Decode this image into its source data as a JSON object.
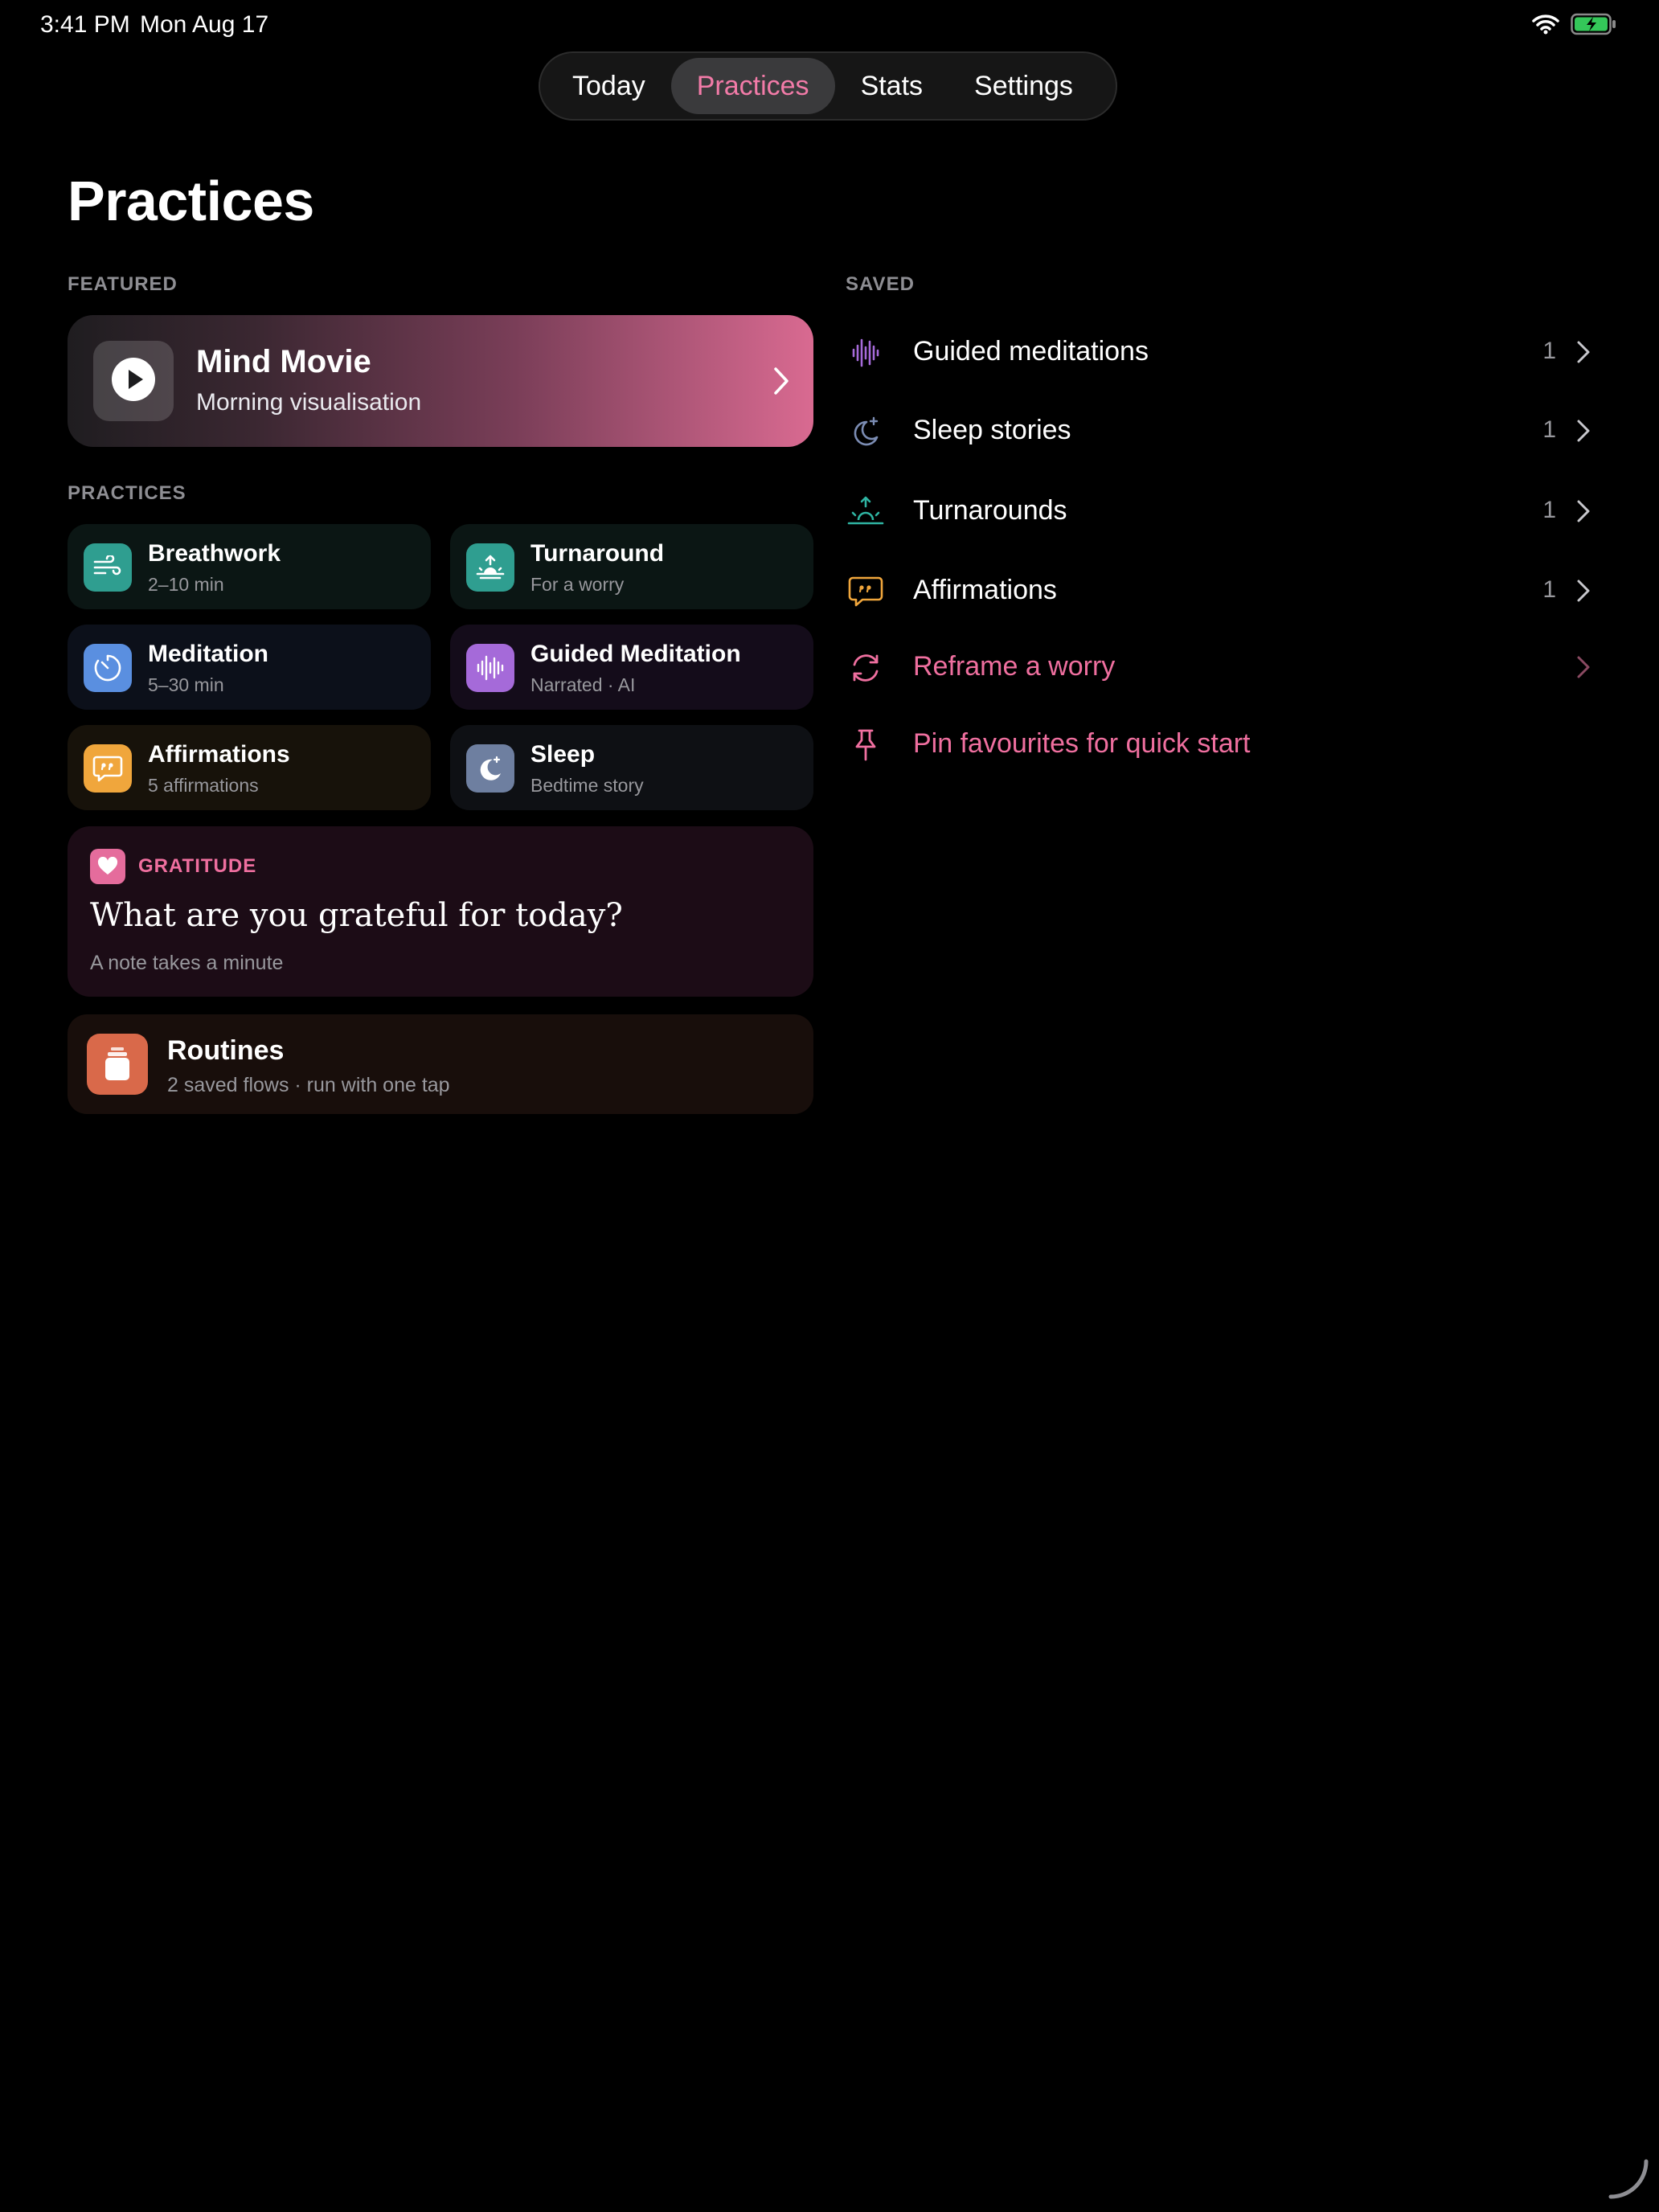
{
  "status": {
    "time": "3:41 PM",
    "date": "Mon Aug 17",
    "wifi_icon": "wifi-icon",
    "battery_icon": "battery-charging-icon"
  },
  "tabs": [
    {
      "label": "Today",
      "active": false
    },
    {
      "label": "Practices",
      "active": true
    },
    {
      "label": "Stats",
      "active": false
    },
    {
      "label": "Settings",
      "active": false
    }
  ],
  "page_title": "Practices",
  "featured": {
    "section_label": "FEATURED",
    "title": "Mind Movie",
    "subtitle": "Morning visualisation",
    "icon": "play-icon"
  },
  "practices": {
    "section_label": "PRACTICES",
    "items": [
      {
        "title": "Breathwork",
        "subtitle": "2–10 min",
        "icon": "wind-icon",
        "color": "#2f9e90"
      },
      {
        "title": "Turnaround",
        "subtitle": "For a worry",
        "icon": "sunrise-icon",
        "color": "#2f9e90"
      },
      {
        "title": "Meditation",
        "subtitle": "5–30 min",
        "icon": "timer-icon",
        "color": "#5a8fe0"
      },
      {
        "title": "Guided Meditation",
        "subtitle": "Narrated · AI",
        "icon": "waveform-icon",
        "color": "#a56ad9"
      },
      {
        "title": "Affirmations",
        "subtitle": "5 affirmations",
        "icon": "quote-bubble-icon",
        "color": "#f0a63c"
      },
      {
        "title": "Sleep",
        "subtitle": "Bedtime story",
        "icon": "moon-stars-icon",
        "color": "#6e7fa0"
      }
    ]
  },
  "gratitude": {
    "label": "GRATITUDE",
    "question": "What are you grateful for today?",
    "note": "A note takes a minute",
    "icon": "heart-icon"
  },
  "routines": {
    "title": "Routines",
    "subtitle": "2 saved flows · run with one tap",
    "icon": "stack-icon"
  },
  "saved": {
    "section_label": "SAVED",
    "items": [
      {
        "label": "Guided meditations",
        "count": "1",
        "icon": "waveform-icon"
      },
      {
        "label": "Sleep stories",
        "count": "1",
        "icon": "moon-stars-icon"
      },
      {
        "label": "Turnarounds",
        "count": "1",
        "icon": "sunrise-icon"
      },
      {
        "label": "Affirmations",
        "count": "1",
        "icon": "quote-bubble-icon"
      }
    ],
    "actions": [
      {
        "label": "Reframe a worry",
        "icon": "refresh-icon"
      },
      {
        "label": "Pin favourites for quick start",
        "icon": "pin-icon"
      }
    ]
  },
  "colors": {
    "accent_pink": "#ef6f9f",
    "background": "#000000"
  }
}
